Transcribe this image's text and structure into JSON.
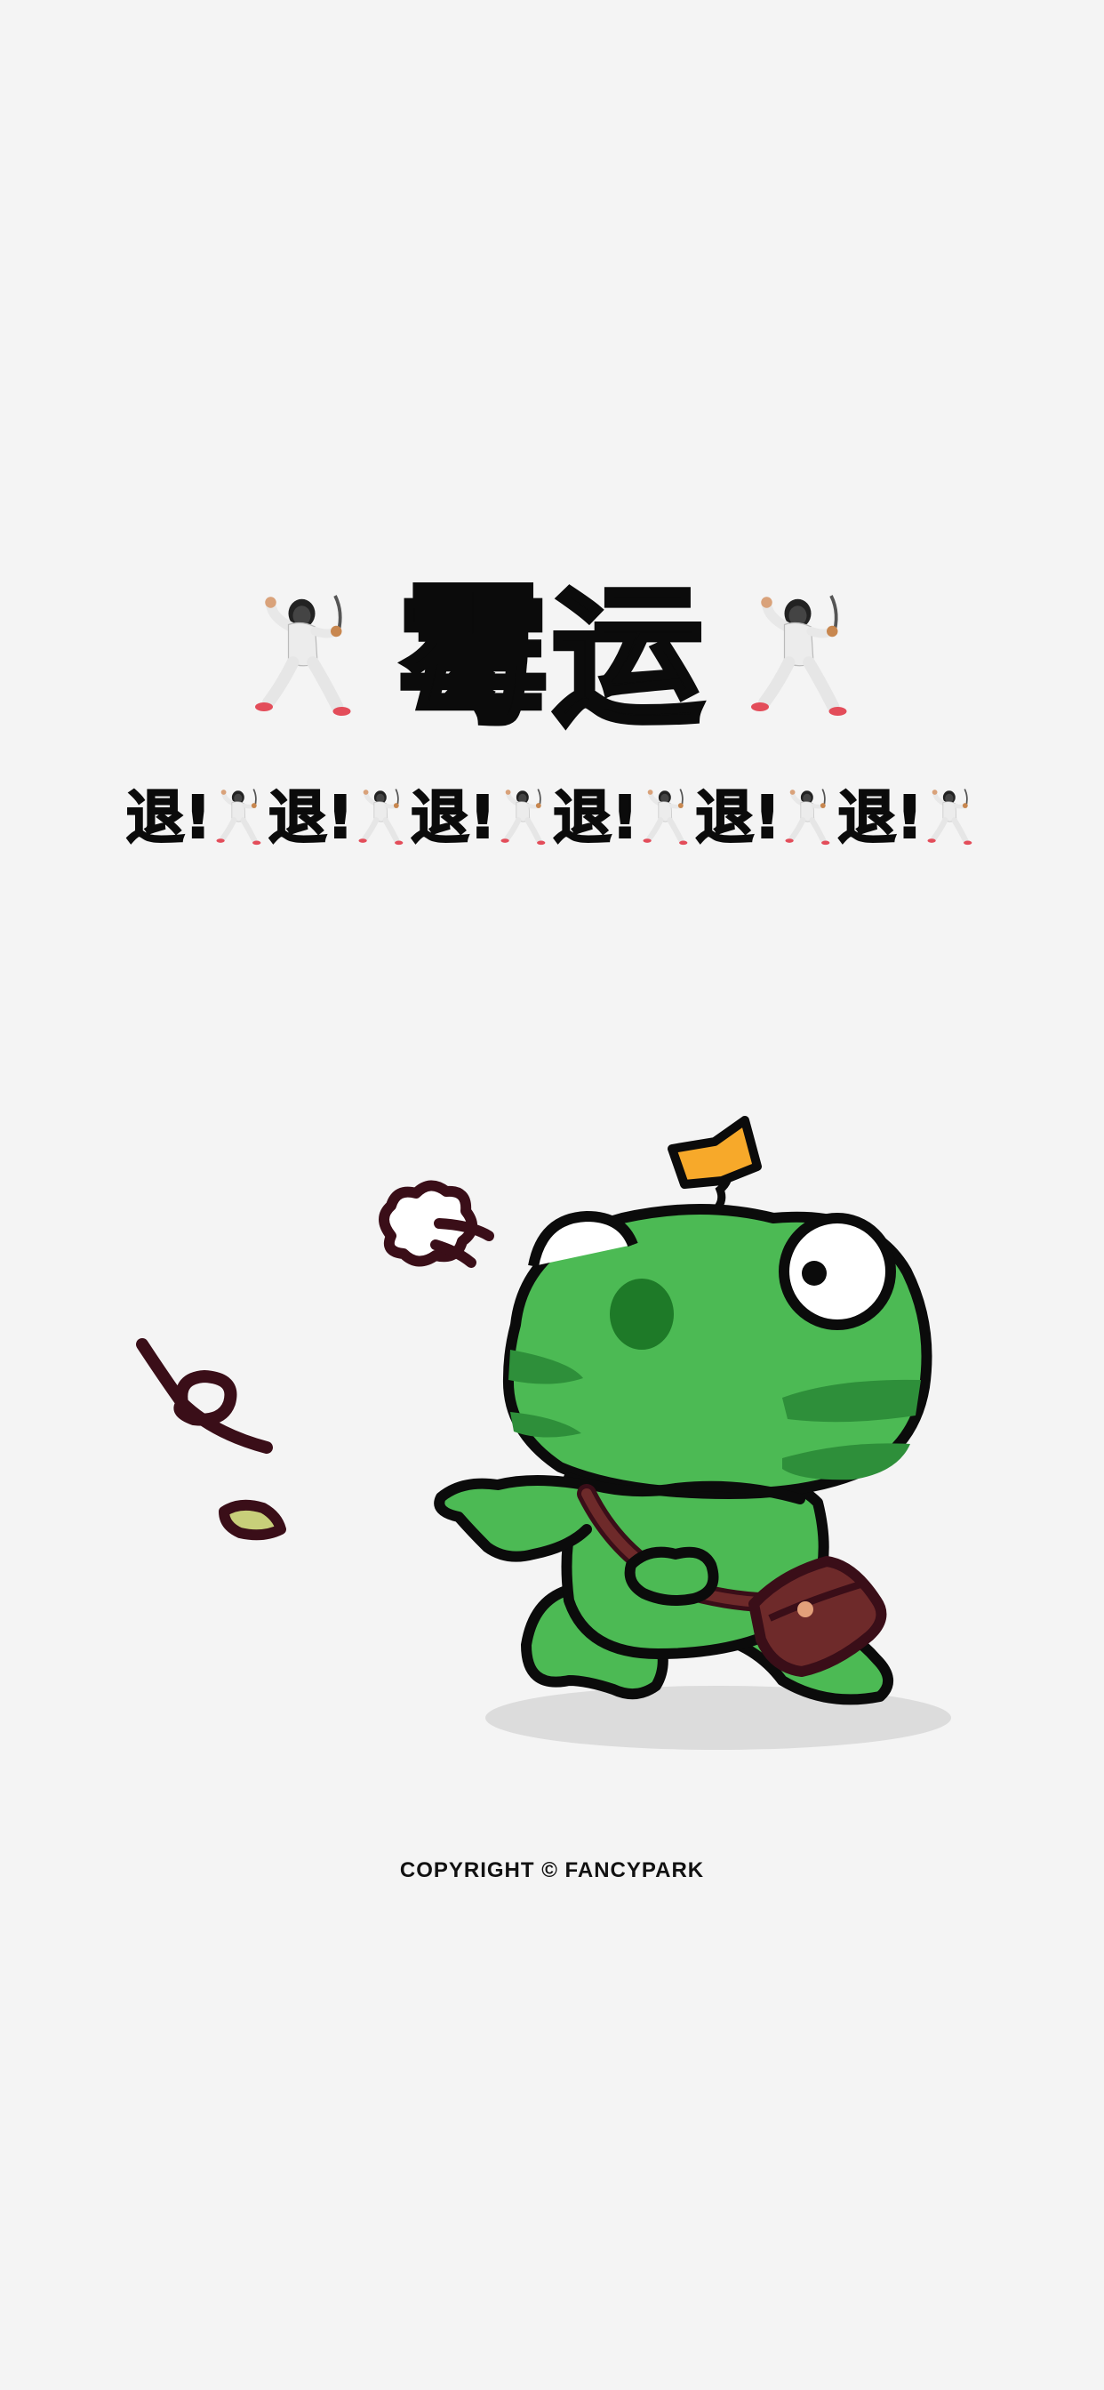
{
  "header": {
    "title": "霉运",
    "chant": [
      "退!",
      "退!",
      "退!",
      "退!",
      "退!",
      "退!"
    ]
  },
  "icons": {
    "fencer": "person-fencing-emoji",
    "character": "green-frog-mascot",
    "puff": "anger-puff-icon",
    "leaf": "falling-leaf-icon"
  },
  "colors": {
    "background": "#f4f4f4",
    "frog_green": "#4cba54",
    "frog_dark": "#2e8f3a",
    "bag": "#6e2a2a",
    "flag": "#f7a92a",
    "outline": "#0b0b0b"
  },
  "footer": {
    "copyright": "COPYRIGHT © FANCYPARK"
  }
}
